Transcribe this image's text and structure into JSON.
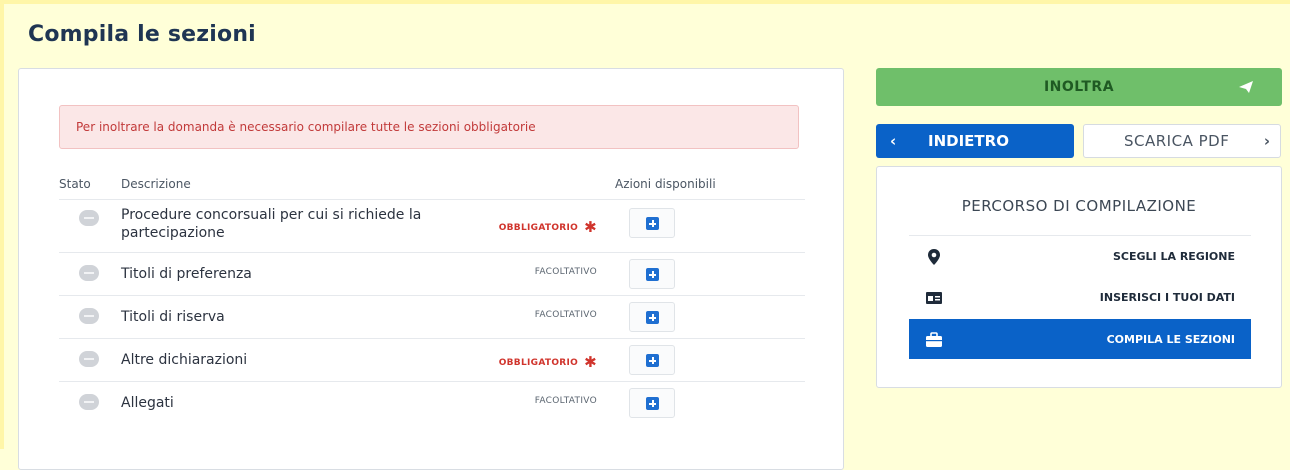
{
  "page": {
    "title": "Compila le sezioni"
  },
  "alert": {
    "text": "Per inoltrare la domanda è necessario compilare tutte le sezioni obbligatorie"
  },
  "table": {
    "headers": {
      "stato": "Stato",
      "descrizione": "Descrizione",
      "azioni": "Azioni disponibili"
    },
    "rows": [
      {
        "descrizione": "Procedure concorsuali per cui si richiede la partecipazione",
        "requirement": "OBBLIGATORIO",
        "required": true
      },
      {
        "descrizione": "Titoli di preferenza",
        "requirement": "FACOLTATIVO",
        "required": false
      },
      {
        "descrizione": "Titoli di riserva",
        "requirement": "FACOLTATIVO",
        "required": false
      },
      {
        "descrizione": "Altre dichiarazioni",
        "requirement": "OBBLIGATORIO",
        "required": true
      },
      {
        "descrizione": "Allegati",
        "requirement": "FACOLTATIVO",
        "required": false
      }
    ],
    "required_star": "✱",
    "action_icon": "plus-square-icon"
  },
  "actions": {
    "inoltra": "INOLTRA",
    "inoltra_icon": "paper-plane-icon",
    "indietro": "INDIETRO",
    "indietro_icon": "‹",
    "scarica_pdf": "SCARICA PDF",
    "scarica_icon": "›"
  },
  "percorso": {
    "title": "PERCORSO DI COMPILAZIONE",
    "items": [
      {
        "label": "SCEGLI LA REGIONE",
        "icon": "map-marker-icon",
        "active": false
      },
      {
        "label": "INSERISCI I TUOI DATI",
        "icon": "id-card-icon",
        "active": false
      },
      {
        "label": "COMPILA LE SEZIONI",
        "icon": "briefcase-icon",
        "active": true
      }
    ]
  },
  "colors": {
    "primary": "#0a62c8",
    "success": "#6fbf6a",
    "danger": "#d0342c",
    "alert_bg": "#fbe7e7"
  }
}
